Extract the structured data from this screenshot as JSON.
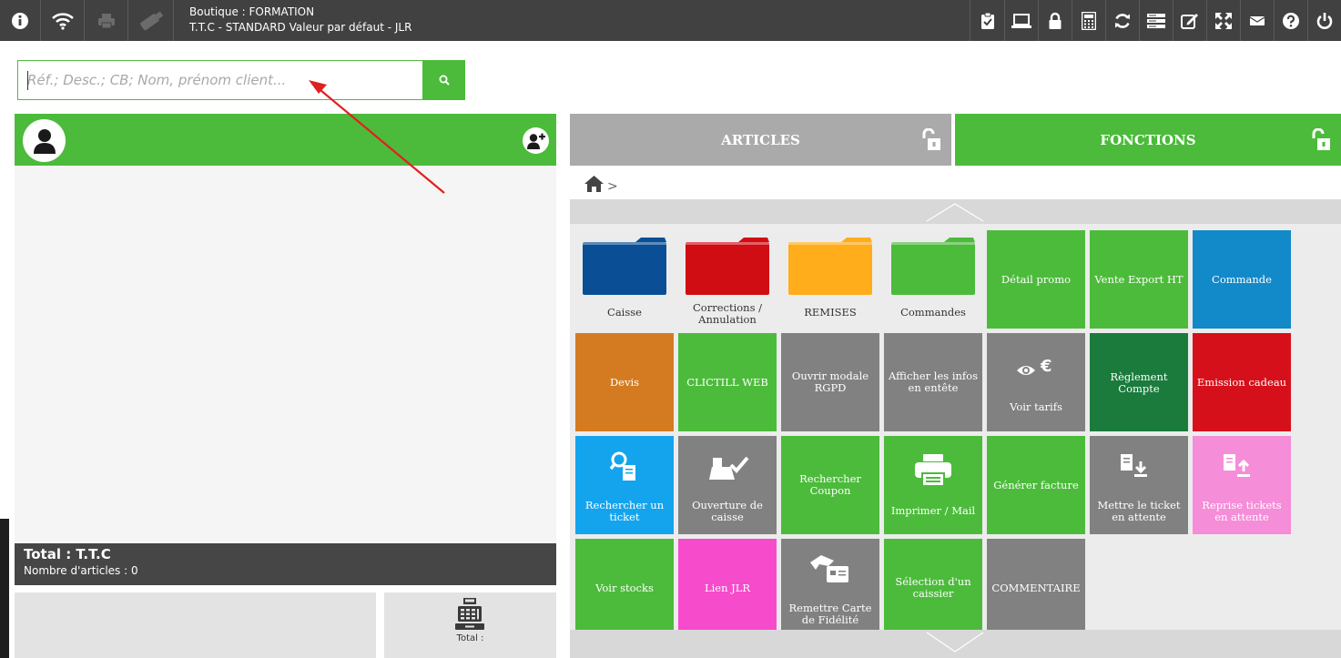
{
  "topbar": {
    "shop_line": "Boutique : FORMATION",
    "tariff_line": "T.T.C - STANDARD Valeur par défaut - JLR",
    "left_icons": [
      "info-icon",
      "wifi-icon",
      "printer-icon",
      "usb-key-icon"
    ],
    "right_icons": [
      "clipboard-check-icon",
      "laptop-icon",
      "lock-icon",
      "calculator-icon",
      "refresh-icon",
      "list-icon",
      "edit-icon",
      "fullscreen-icon",
      "mail-icon",
      "help-icon",
      "power-icon"
    ]
  },
  "search": {
    "placeholder": "Réf.; Desc.; CB; Nom, prénom client..."
  },
  "tabs": {
    "articles": "ARTICLES",
    "fonctions": "FONCTIONS"
  },
  "breadcrumb": {
    "separator": ">"
  },
  "ticket": {
    "total_title": "Total : T.T.C",
    "item_count_label": "Nombre d'articles : 0",
    "total_label": "Total :"
  },
  "folders": [
    {
      "label": "Caisse",
      "color": "#0a4f96"
    },
    {
      "label": "Corrections / Annulation",
      "color": "#d10d14"
    },
    {
      "label": "REMISES",
      "color": "#ffad1a"
    },
    {
      "label": "Commandes",
      "color": "#4cbb3b"
    }
  ],
  "tiles": {
    "detail_promo": "Détail promo",
    "vente_export": "Vente Export HT",
    "commande": "Commande",
    "devis": "Devis",
    "clictill": "CLICTILL WEB",
    "rgpd": "Ouvrir modale RGPD",
    "afficher_infos": "Afficher les infos en entête",
    "voir_tarifs": "Voir tarifs",
    "reglement_compte": "Règlement Compte",
    "emission_cadeau": "Emission cadeau",
    "rechercher_ticket": "Rechercher un ticket",
    "ouverture_caisse": "Ouverture de caisse",
    "rechercher_coupon": "Rechercher Coupon",
    "imprimer_mail": "Imprimer / Mail",
    "generer_facture": "Générer facture",
    "mettre_attente": "Mettre le ticket en attente",
    "reprise_tickets": "Reprise tickets en attente",
    "voir_stocks": "Voir stocks",
    "lien_jlr": "Lien JLR",
    "remettre_carte": "Remettre Carte de Fidélité",
    "selection_caissier": "Sélection d'un caissier",
    "commentaire": "COMMENTAIRE"
  },
  "colors": {
    "green": "#4cbb3b",
    "topbar": "#414141",
    "annotation_arrow": "#e02020"
  }
}
